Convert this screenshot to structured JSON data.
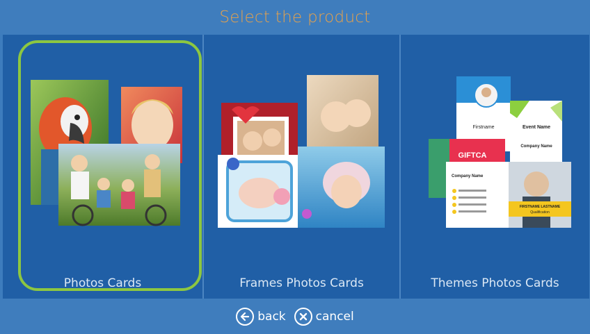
{
  "header": {
    "title": "Select the product"
  },
  "products": [
    {
      "label": "Photos Cards",
      "selected": true
    },
    {
      "label": "Frames Photos Cards",
      "selected": false
    },
    {
      "label": "Themes Photos Cards",
      "selected": false
    }
  ],
  "theme_card_text": {
    "firstname": "Firstname",
    "event_name": "Event Name",
    "company_name": "Company Name",
    "giftcard": "GIFTCA",
    "company_name_2": "Company Name",
    "firstname_lastname": "FIRSTNAME LASTNAME",
    "qualification": "Qualification"
  },
  "footer": {
    "back_label": "back",
    "cancel_label": "cancel"
  },
  "colors": {
    "accent_title": "#e8a24a",
    "selection_border": "#8dc741",
    "background": "#205fa6",
    "bar": "#3f7dbd"
  },
  "icons": {
    "back": "arrow-left-circle-icon",
    "cancel": "x-circle-icon"
  }
}
